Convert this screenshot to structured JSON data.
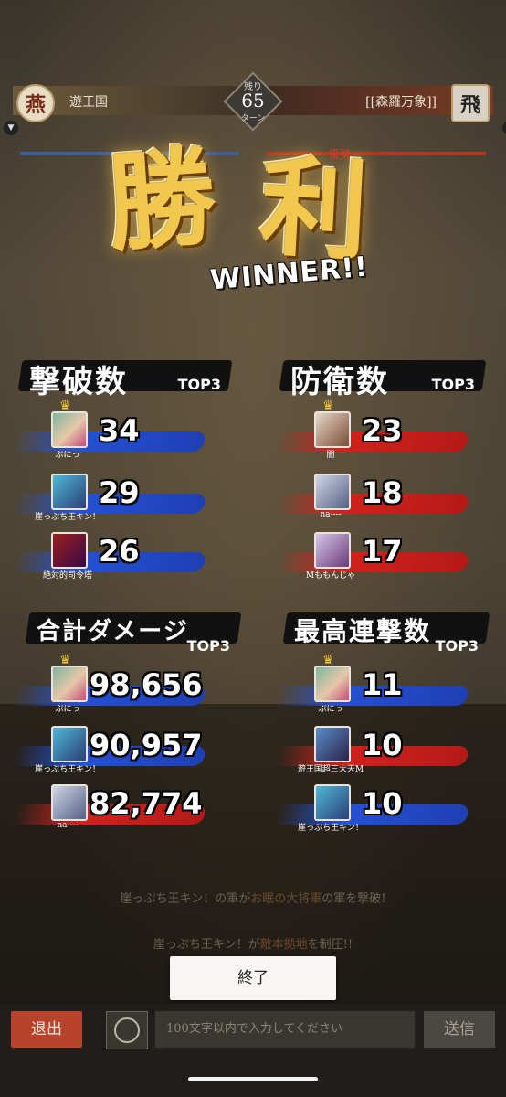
{
  "header": {
    "left_emblem": "燕",
    "left_team": "遊王国",
    "right_emblem": "飛",
    "right_team": "[[森羅万象]]",
    "turns_label_top": "残り",
    "turns_value": "65",
    "turns_label_bottom": "ターン",
    "advantage": "優勢"
  },
  "victory": {
    "kanji1": "勝",
    "kanji2": "利",
    "winner": "WINNER!!"
  },
  "categories": {
    "kills": {
      "title": "撃破数",
      "tag": "TOP3"
    },
    "defense": {
      "title": "防衛数",
      "tag": "TOP3"
    },
    "damage": {
      "title": "合計ダメージ",
      "tag": "TOP3"
    },
    "combo": {
      "title": "最高連撃数",
      "tag": "TOP3"
    }
  },
  "kills": [
    {
      "name": "ぷにっ",
      "value": "34"
    },
    {
      "name": "崖っぷち王キン！",
      "value": "29"
    },
    {
      "name": "絶対的司令塔",
      "value": "26"
    }
  ],
  "defense": [
    {
      "name": "闇",
      "value": "23"
    },
    {
      "name": "na----",
      "value": "18"
    },
    {
      "name": "Mももんじゃ",
      "value": "17"
    }
  ],
  "damage": [
    {
      "name": "ぷにっ",
      "value": "98,656"
    },
    {
      "name": "崖っぷち王キン！",
      "value": "90,957"
    },
    {
      "name": "na----",
      "value": "82,774"
    }
  ],
  "combo": [
    {
      "name": "ぷにっ",
      "value": "11"
    },
    {
      "name": "遊王国超三大天M",
      "value": "10"
    },
    {
      "name": "崖っぷち王キン！",
      "value": "10"
    }
  ],
  "messages": {
    "m1_a": "崖っぷち王キン！の軍が",
    "m1_b": "お眠の大将軍",
    "m1_c": "の軍を撃破!",
    "m2_a": "崖っぷち王キン！が",
    "m2_b": "敵本拠地",
    "m2_c": "を制圧!!"
  },
  "end_button": "終了",
  "bottom": {
    "exit": "退出",
    "chat_placeholder": "100文字以内で入力してください",
    "send": "送信"
  },
  "colors": {
    "blue_team": "#2551d3",
    "red_team": "#d2221d",
    "gold": "#f2c74e"
  },
  "icons": {
    "emoji_button": "smiley-icon",
    "crown": "crown-icon"
  }
}
